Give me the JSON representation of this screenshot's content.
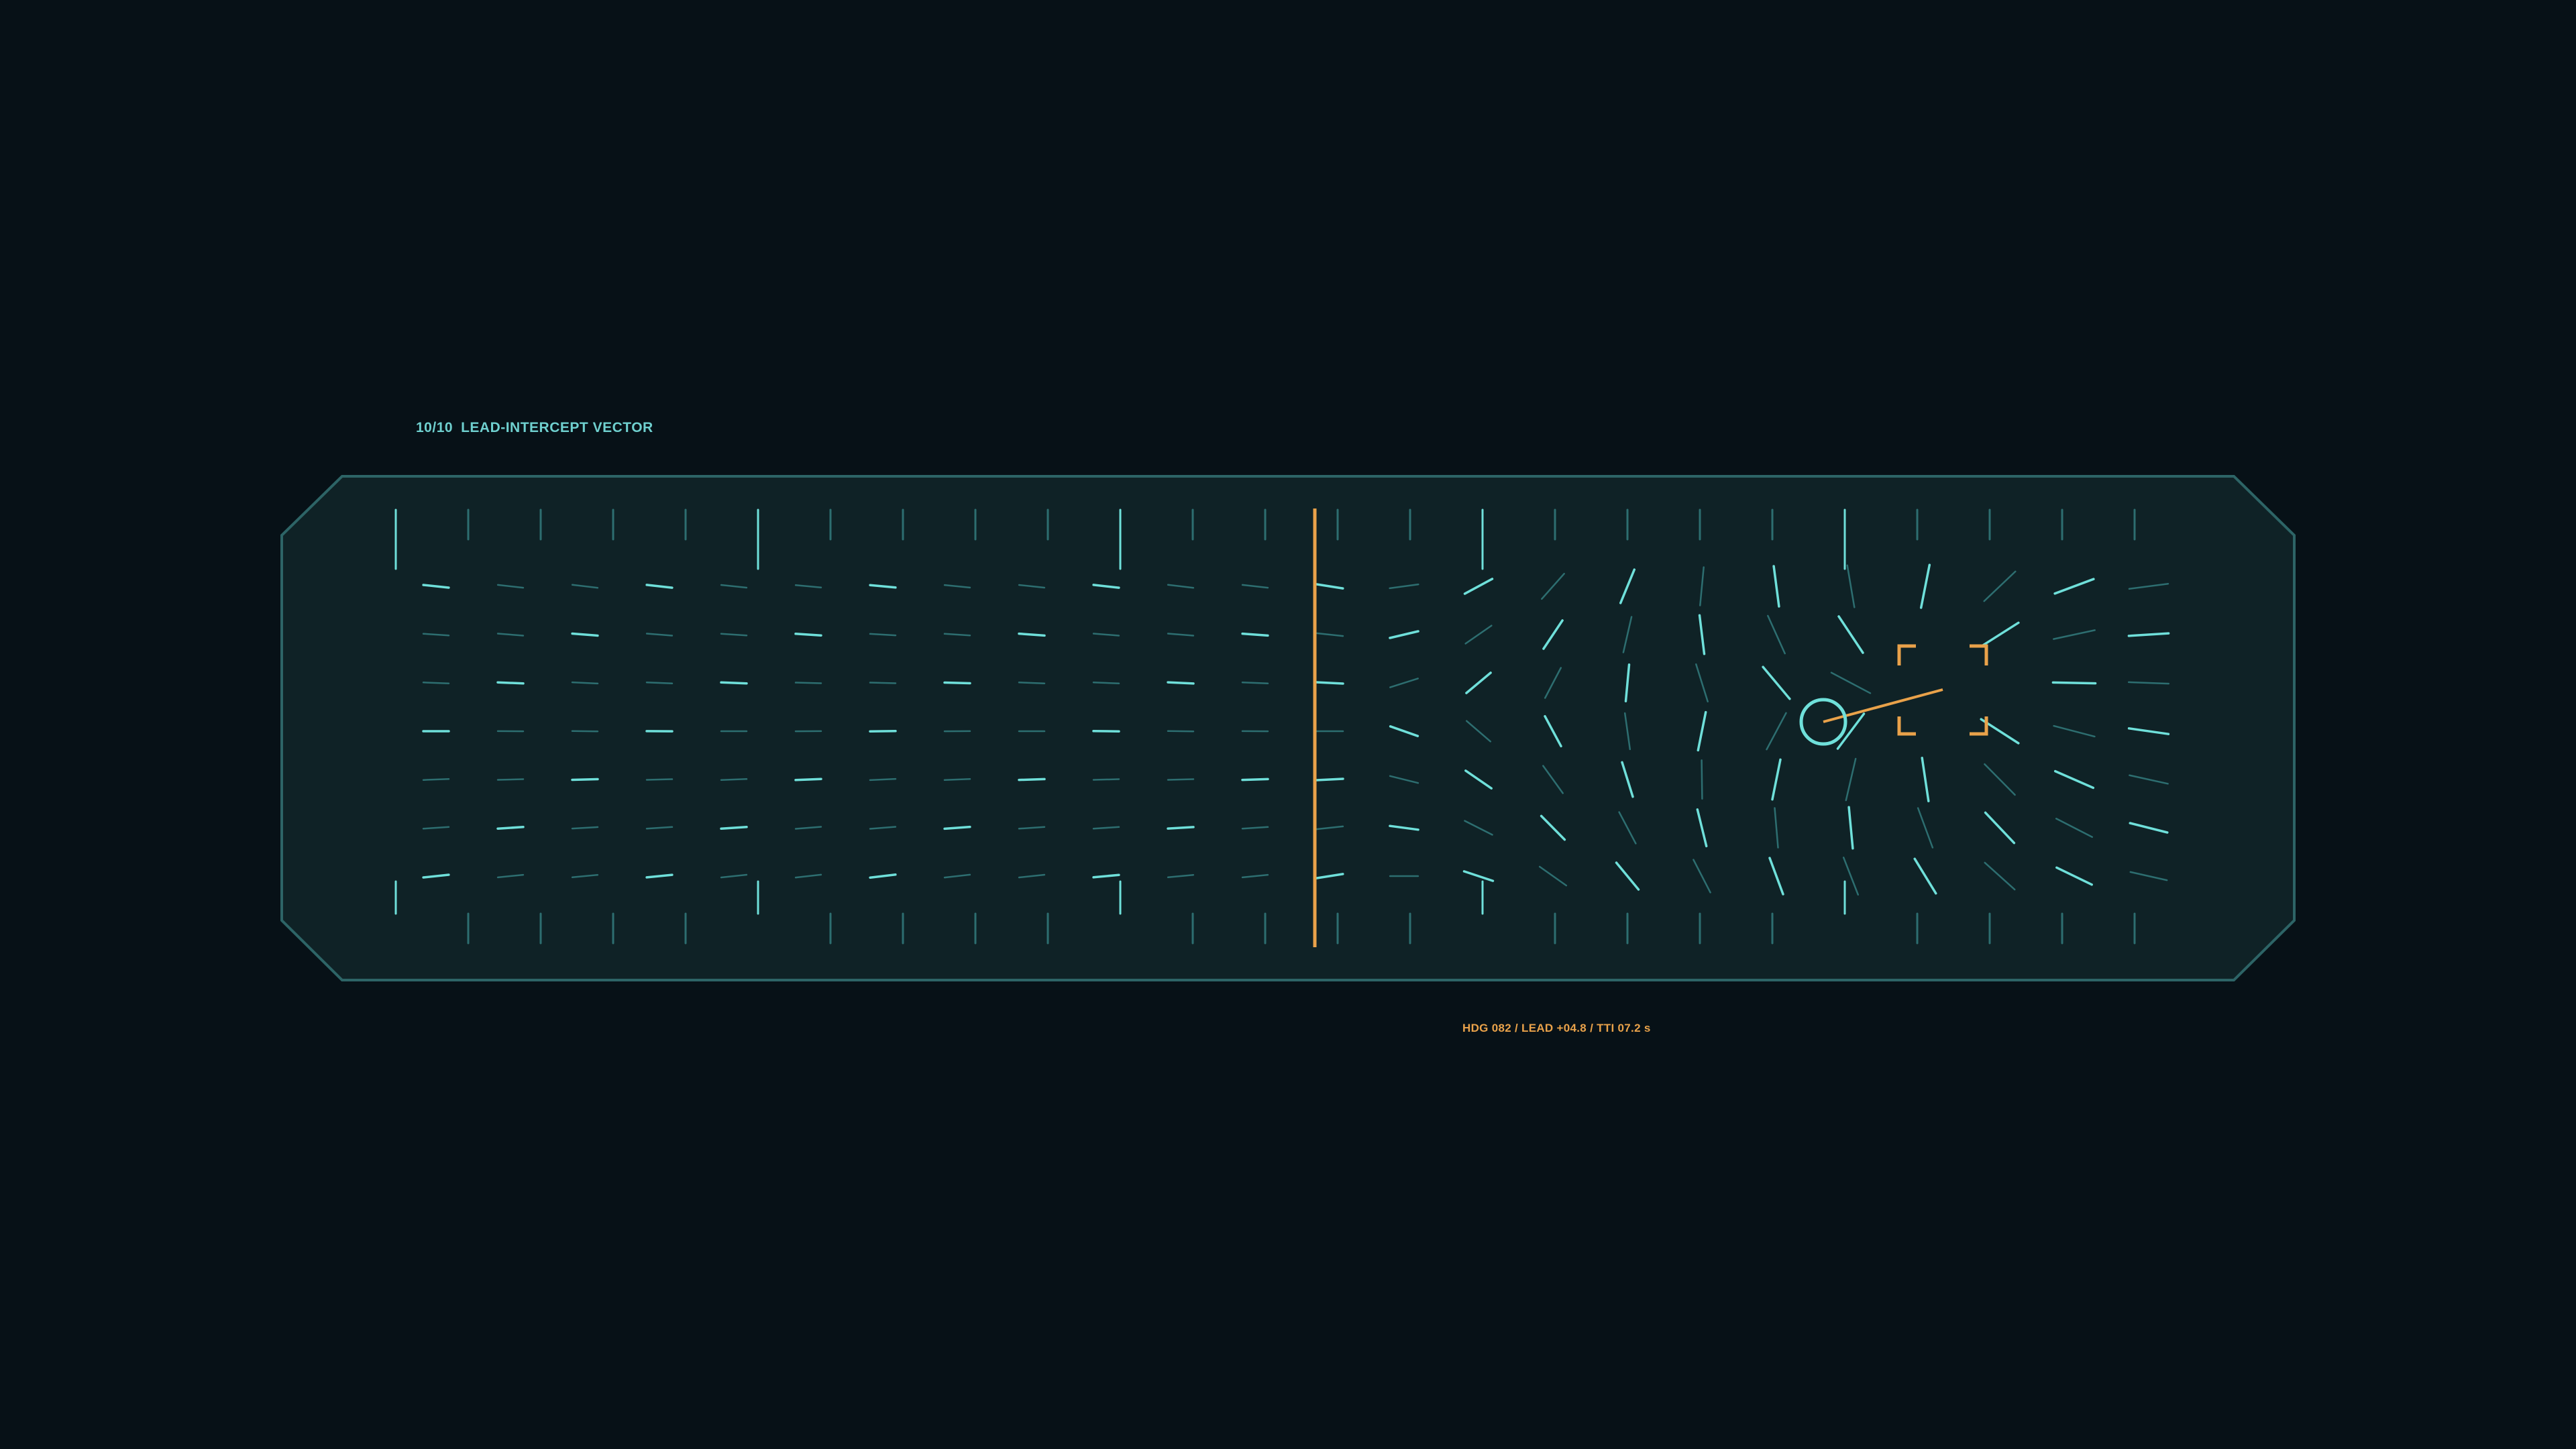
{
  "panel": {
    "page_indicator": "10/10",
    "title": "LEAD-INTERCEPT VECTOR"
  },
  "readout": {
    "text": "HDG 082 / LEAD +04.8 / TTI 07.2 s"
  },
  "colors": {
    "background": "#071117",
    "panel_fill": "#0f2226",
    "panel_border": "#2d6466",
    "accent_cyan": "#6fe0da",
    "dim_cyan": "#2d6e70",
    "accent_orange": "#e9a24a"
  },
  "icons": {
    "interceptor_marker": "circle-marker-icon",
    "target_bracket": "target-bracket-icon"
  }
}
